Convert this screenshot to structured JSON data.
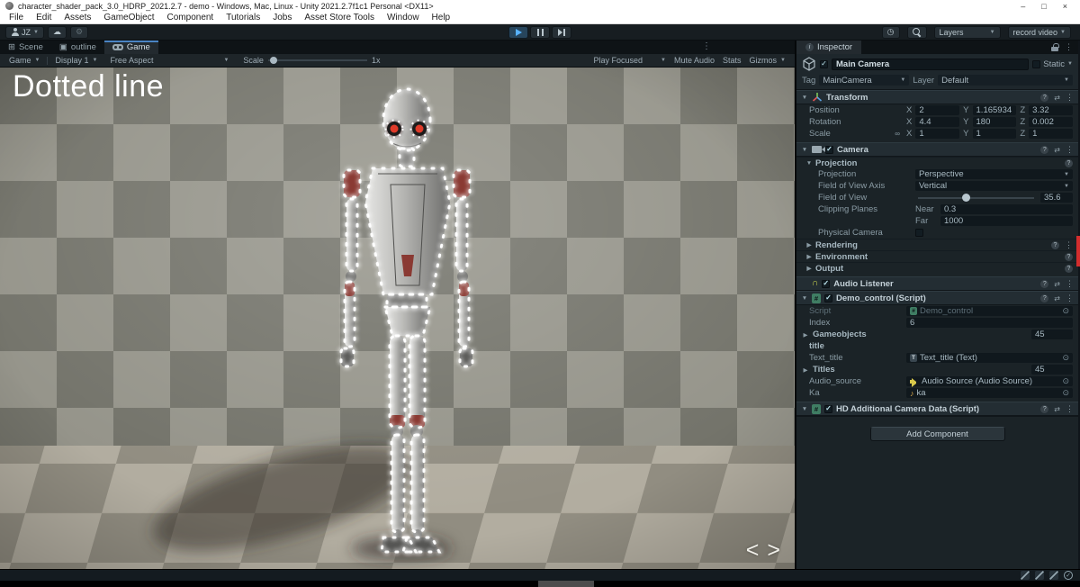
{
  "window": {
    "title": "character_shader_pack_3.0_HDRP_2021.2.7 - demo - Windows, Mac, Linux - Unity 2021.2.7f1c1 Personal <DX11>",
    "minimize": "–",
    "maximize": "□",
    "close": "×"
  },
  "menubar": {
    "items": [
      "File",
      "Edit",
      "Assets",
      "GameObject",
      "Component",
      "Tutorials",
      "Jobs",
      "Asset Store Tools",
      "Window",
      "Help"
    ]
  },
  "toolbar": {
    "account": "JZ",
    "layers": "Layers",
    "record": "record video"
  },
  "tabs": {
    "scene": "Scene",
    "outline": "outline",
    "game": "Game"
  },
  "gamebar": {
    "target": "Game",
    "display": "Display 1",
    "aspect": "Free Aspect",
    "scale_label": "Scale",
    "scale_value": "1x",
    "play_focused": "Play Focused",
    "mute_audio": "Mute Audio",
    "stats": "Stats",
    "gizmos": "Gizmos"
  },
  "viewport": {
    "overlay_text": "Dotted line",
    "nav_prev": "<",
    "nav_next": ">"
  },
  "inspector": {
    "tab": "Inspector",
    "header": {
      "name": "Main Camera",
      "static_label": "Static",
      "tag_label": "Tag",
      "tag_value": "MainCamera",
      "layer_label": "Layer",
      "layer_value": "Default"
    },
    "transform": {
      "title": "Transform",
      "axis": {
        "x": "X",
        "y": "Y",
        "z": "Z"
      },
      "rows": [
        {
          "label": "Position",
          "x": "2",
          "y": "1.165934",
          "z": "3.32"
        },
        {
          "label": "Rotation",
          "x": "4.4",
          "y": "180",
          "z": "0.002"
        },
        {
          "label": "Scale",
          "x": "1",
          "y": "1",
          "z": "1"
        }
      ]
    },
    "camera": {
      "title": "Camera",
      "projection_group": "Projection",
      "projection_label": "Projection",
      "projection_value": "Perspective",
      "fov_axis_label": "Field of View Axis",
      "fov_axis_value": "Vertical",
      "fov_label": "Field of View",
      "fov_value": "35.6",
      "clipping_label": "Clipping Planes",
      "near_label": "Near",
      "near_value": "0.3",
      "far_label": "Far",
      "far_value": "1000",
      "physical_label": "Physical Camera",
      "collapsed": [
        "Rendering",
        "Environment",
        "Output"
      ]
    },
    "audio_listener": {
      "title": "Audio Listener"
    },
    "demo": {
      "title": "Demo_control (Script)",
      "script_label": "Script",
      "script_value": "Demo_control",
      "index_label": "Index",
      "index_value": "6",
      "gameobjects_label": "Gameobjects",
      "gameobjects_count": "45",
      "group_title": "title",
      "text_title_label": "Text_title",
      "text_title_value": "Text_title (Text)",
      "titles_label": "Titles",
      "titles_count": "45",
      "audio_source_label": "Audio_source",
      "audio_source_value": "Audio Source (Audio Source)",
      "ka_label": "Ka",
      "ka_value": "ka"
    },
    "hd": {
      "title": "HD Additional Camera Data (Script)"
    },
    "add_component": "Add Component"
  },
  "icons": {
    "check": "✓",
    "dropdown": "▼",
    "foldout_open": "▼",
    "foldout_closed": "▶",
    "kebab": "⋮",
    "help": "?",
    "preset": "⇄",
    "cloud": "☁",
    "gear": "⚙",
    "clock": "◷",
    "grid": "⊞",
    "package": "▣",
    "info": "i",
    "picker": "⊙",
    "link": "∞",
    "headphones": "∩",
    "note": "♪",
    "hash": "#",
    "letter_t": "T"
  },
  "colors": {
    "accent_blue": "#4a84c4",
    "play_blue": "#57b1ff",
    "red_marker": "#d32d2d",
    "glow_white": "#ffffff",
    "eye_red": "#e03a2a"
  }
}
